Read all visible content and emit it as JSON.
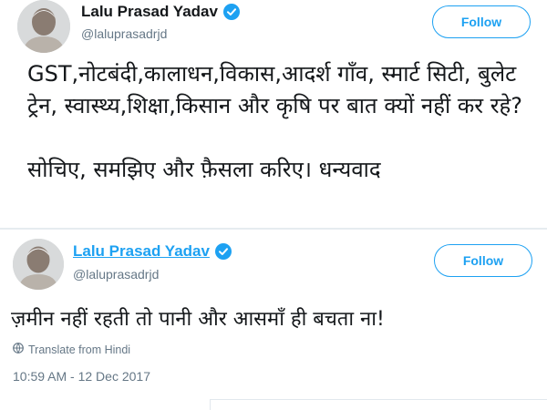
{
  "tweets": [
    {
      "display_name": "Lalu Prasad Yadav",
      "handle": "@laluprasadrjd",
      "follow_label": "Follow",
      "text": "GST,नोटबंदी,कालाधन,विकास,आदर्श गाँव, स्मार्ट सिटी, बुलेट ट्रेन, स्वास्थ्य,शिक्षा,किसान और कृषि पर बात क्यों नहीं कर रहे?\n\nसोचिए, समझिए और फ़ैसला करिए। धन्यवाद"
    },
    {
      "display_name": "Lalu Prasad Yadav",
      "handle": "@laluprasadrjd",
      "follow_label": "Follow",
      "text": "ज़मीन नहीं रहती तो पानी और आसमाँ ही बचता ना!",
      "translate_label": "Translate from Hindi",
      "timestamp": "10:59 AM - 12 Dec 2017"
    }
  ],
  "colors": {
    "accent": "#1da1f2",
    "secondary_text": "#657786",
    "primary_text": "#14171a"
  },
  "icons": {
    "verified": "verified-badge-icon",
    "translate": "globe-icon"
  }
}
